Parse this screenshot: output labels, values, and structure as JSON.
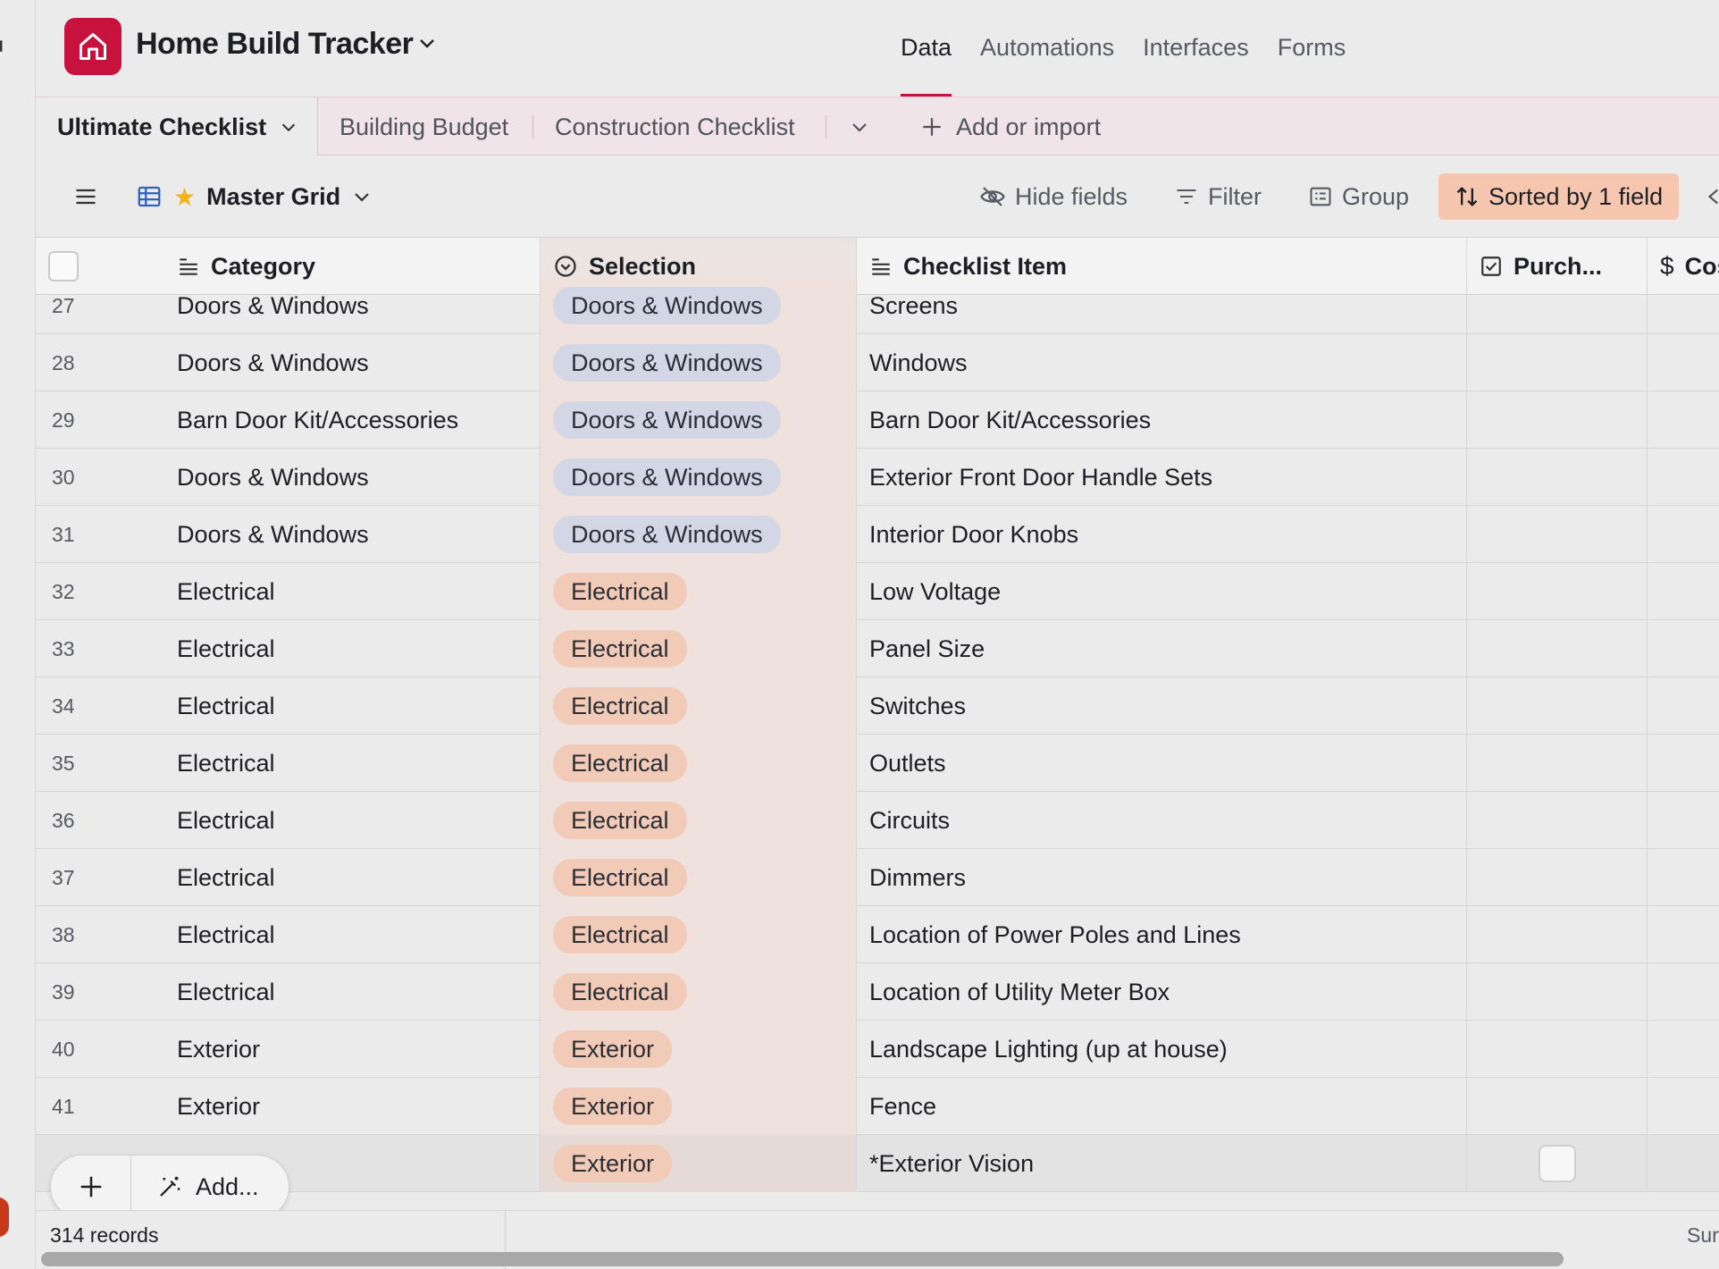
{
  "app": {
    "title": "Home Build Tracker",
    "brand_color": "#c8123e"
  },
  "nav": {
    "tabs": [
      "Data",
      "Automations",
      "Interfaces",
      "Forms"
    ],
    "active": "Data"
  },
  "tables": {
    "active": "Ultimate Checklist",
    "others": [
      "Building Budget",
      "Construction Checklist"
    ],
    "add_label": "Add or import"
  },
  "view": {
    "name": "Master Grid",
    "hide_fields": "Hide fields",
    "filter": "Filter",
    "group": "Group",
    "sort": "Sorted by 1 field",
    "sort_color": "#f6c6ae"
  },
  "columns": {
    "category": "Category",
    "selection": "Selection",
    "item": "Checklist Item",
    "purchased": "Purch...",
    "cost": "Cost"
  },
  "pill_colors": {
    "Doors & Windows": "#d3d6e4",
    "Electrical": "#f2cbb8",
    "Exterior": "#f2cbb8"
  },
  "rows": [
    {
      "num": "27",
      "category": "Doors & Windows",
      "selection": "Doors & Windows",
      "item": "Screens"
    },
    {
      "num": "28",
      "category": "Doors & Windows",
      "selection": "Doors & Windows",
      "item": "Windows"
    },
    {
      "num": "29",
      "category": "Barn Door Kit/Accessories",
      "selection": "Doors & Windows",
      "item": "Barn Door Kit/Accessories"
    },
    {
      "num": "30",
      "category": "Doors & Windows",
      "selection": "Doors & Windows",
      "item": "Exterior Front Door Handle Sets"
    },
    {
      "num": "31",
      "category": "Doors & Windows",
      "selection": "Doors & Windows",
      "item": "Interior Door Knobs"
    },
    {
      "num": "32",
      "category": "Electrical",
      "selection": "Electrical",
      "item": "Low Voltage"
    },
    {
      "num": "33",
      "category": "Electrical",
      "selection": "Electrical",
      "item": "Panel Size"
    },
    {
      "num": "34",
      "category": "Electrical",
      "selection": "Electrical",
      "item": "Switches"
    },
    {
      "num": "35",
      "category": "Electrical",
      "selection": "Electrical",
      "item": "Outlets"
    },
    {
      "num": "36",
      "category": "Electrical",
      "selection": "Electrical",
      "item": "Circuits"
    },
    {
      "num": "37",
      "category": "Electrical",
      "selection": "Electrical",
      "item": "Dimmers"
    },
    {
      "num": "38",
      "category": "Electrical",
      "selection": "Electrical",
      "item": "Location of Power Poles and Lines"
    },
    {
      "num": "39",
      "category": "Electrical",
      "selection": "Electrical",
      "item": "Location of Utility Meter Box"
    },
    {
      "num": "40",
      "category": "Exterior",
      "selection": "Exterior",
      "item": "Landscape Lighting (up at house)"
    },
    {
      "num": "41",
      "category": "Exterior",
      "selection": "Exterior",
      "item": "Fence"
    },
    {
      "num": "",
      "category": "",
      "selection": "Exterior",
      "item": "*Exterior Vision",
      "show_checkbox": true
    }
  ],
  "add_widget": {
    "label": "Add..."
  },
  "footer": {
    "records": "314 records",
    "summary": "Sur"
  }
}
